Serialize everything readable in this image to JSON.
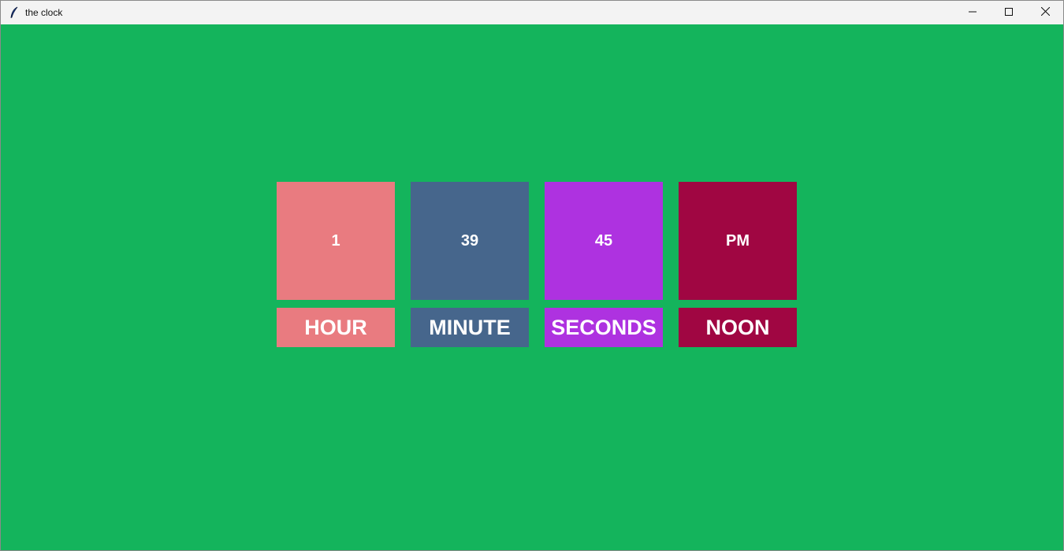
{
  "window": {
    "title": "the clock",
    "app_icon": "feather-icon",
    "controls": [
      "minimize-icon",
      "maximize-icon",
      "close-icon"
    ]
  },
  "colors": {
    "background": "#14b45c",
    "hour": "#e97b80",
    "minute": "#46668c",
    "seconds": "#ae32e0",
    "noon": "#a00642",
    "text": "#ffffff"
  },
  "clock": {
    "hour": {
      "value": "1",
      "label": "HOUR"
    },
    "minute": {
      "value": "39",
      "label": "MINUTE"
    },
    "seconds": {
      "value": "45",
      "label": "SECONDS"
    },
    "noon": {
      "value": "PM",
      "label": "NOON"
    }
  }
}
